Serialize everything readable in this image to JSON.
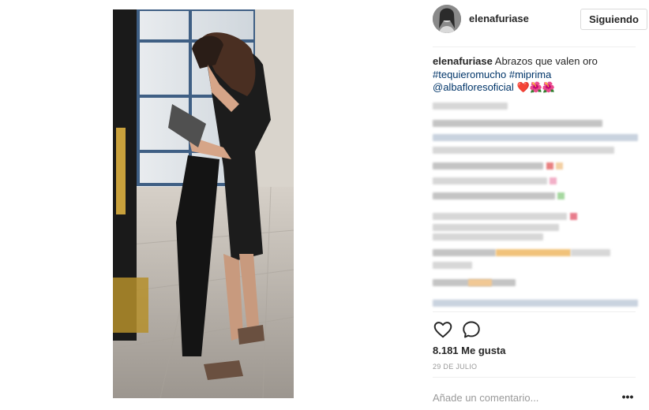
{
  "post": {
    "username": "elenafuriase",
    "follow_button": "Siguiendo",
    "caption": {
      "user": "elenafuriase",
      "text": "Abrazos que valen oro",
      "hashtags": "#tequieromucho #miprima",
      "mention": "@albafloresoficial",
      "emojis": "❤️🌺🌺"
    },
    "actions": {
      "like_icon": "heart-outline-icon",
      "comment_icon": "speech-bubble-icon"
    },
    "likes_text": "8.181 Me gusta",
    "date": "29 DE JULIO",
    "comment_placeholder": "Añade un comentario...",
    "more_label": "•••"
  },
  "colors": {
    "text": "#262626",
    "hashtag": "#003569",
    "muted": "#999999",
    "border": "#dbdbdb"
  }
}
